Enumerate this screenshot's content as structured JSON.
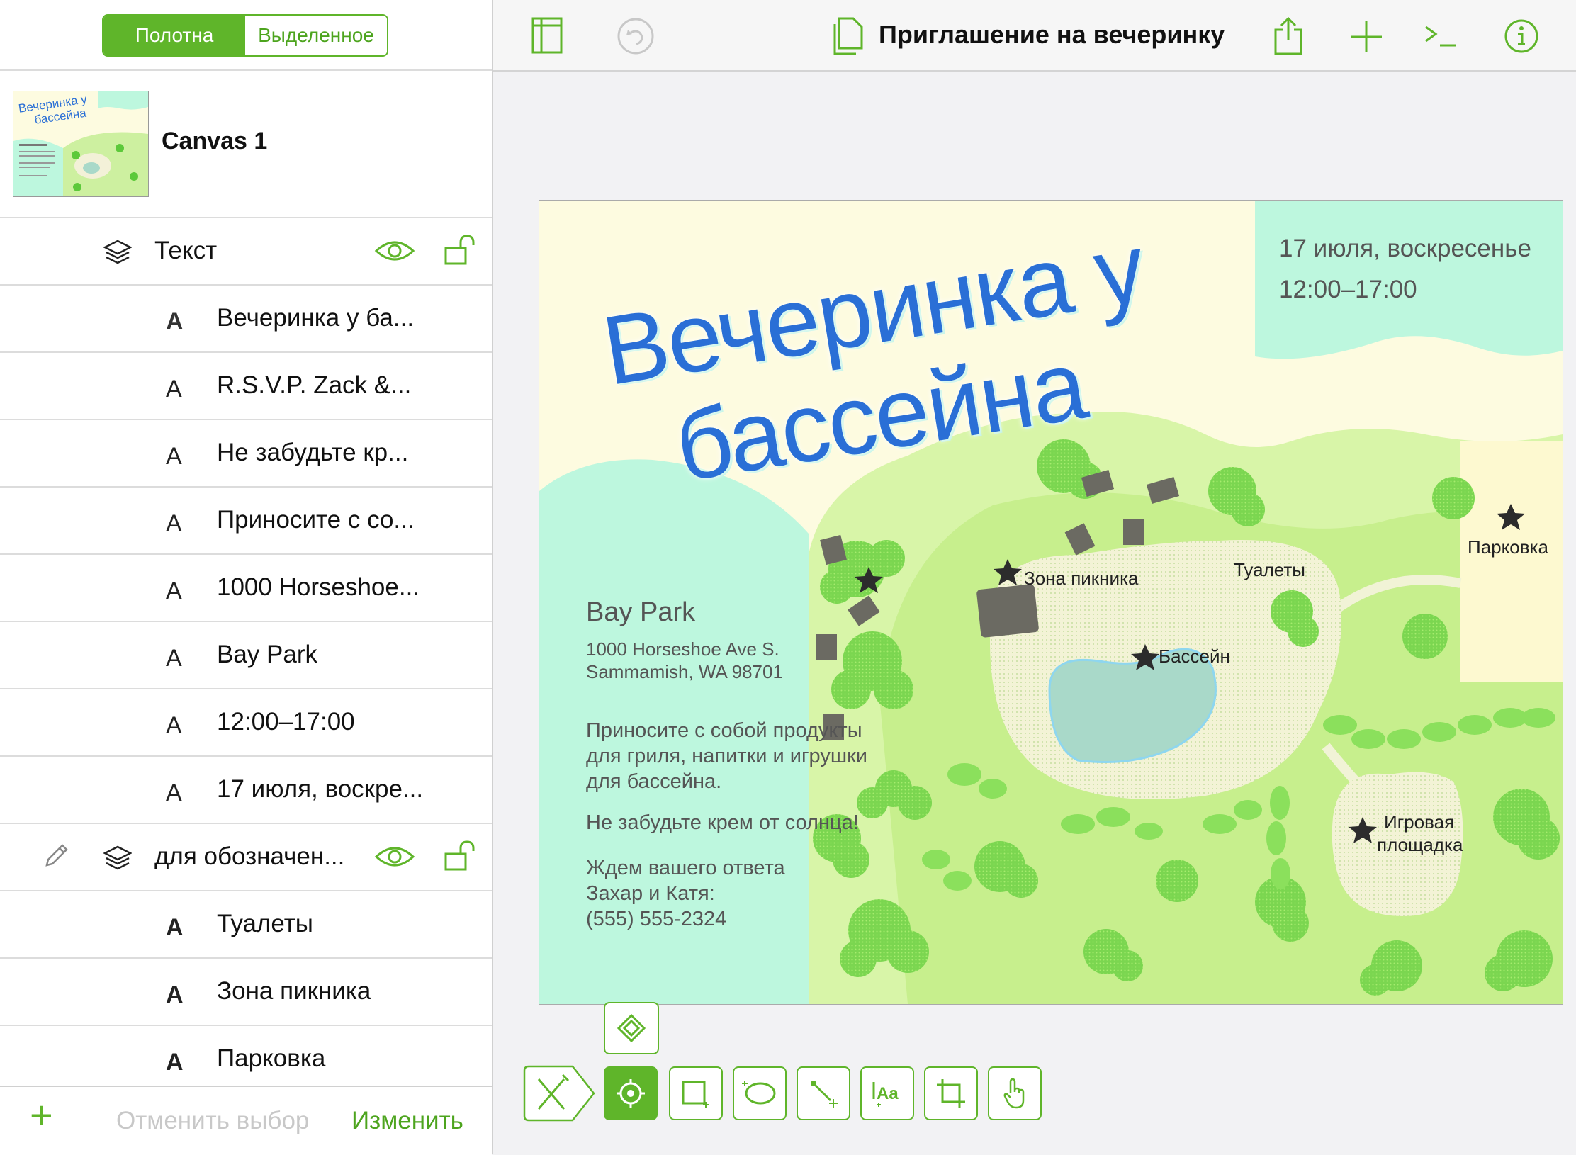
{
  "sidebar": {
    "segments": {
      "active": "Полотна",
      "inactive": "Выделенное"
    },
    "canvas_name": "Canvas 1",
    "group1": {
      "label": "Текст"
    },
    "group1_items": [
      "Вечеринка у  ба...",
      "R.S.V.P. Zack &...",
      "Не забудьте кр...",
      "Приносите с со...",
      "1000 Horseshoe...",
      "Bay Park",
      "12:00–17:00",
      "17 июля, воскре..."
    ],
    "group2": {
      "label": "для обозначен..."
    },
    "group2_items": [
      "Туалеты",
      "Зона пикника",
      "Парковка"
    ],
    "bottom": {
      "add": "+",
      "deselect": "Отменить выбор",
      "edit": "Изменить"
    }
  },
  "toolbar": {
    "title": "Приглашение на вечеринку"
  },
  "invitation": {
    "title_line1": "Вечеринка у",
    "title_line2": "бассейна",
    "date": "17 июля, воскресенье",
    "time": "12:00–17:00",
    "place": "Bay Park",
    "address1": "1000 Horseshoe Ave S.",
    "address2": "Sammamish, WA 98701",
    "bring1": "Приносите с собой продукты",
    "bring2": "для гриля, напитки и игрушки",
    "bring3": "для бассейна.",
    "sunscreen": "Не забудьте крем от солнца!",
    "rsvp1": "Ждем вашего ответа",
    "rsvp2": "Захар и Катя:",
    "rsvp3": "(555) 555-2324"
  },
  "map_labels": {
    "picnic": "Зона пикника",
    "toilets": "Туалеты",
    "pool": "Бассейн",
    "parking": "Парковка",
    "playground1": "Игровая",
    "playground2": "площадка"
  },
  "thumb": {
    "line1": "Вечеринка у",
    "line2": "бассейна"
  },
  "colors": {
    "accent": "#5fb52a",
    "title_blue": "#2a6fd6",
    "mint": "#bdf7de",
    "grass": "#cdf0a0"
  }
}
